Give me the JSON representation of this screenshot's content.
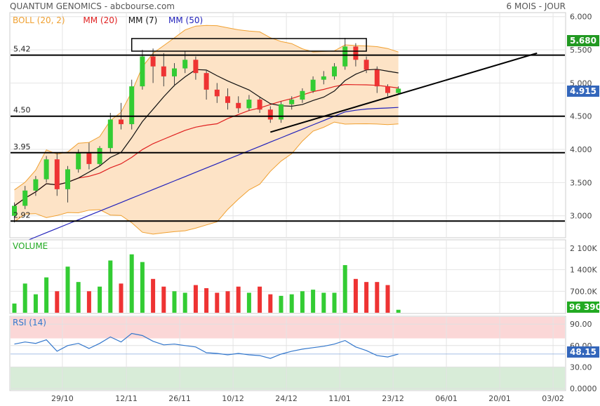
{
  "header": {
    "title": "QUANTUM GENOMICS - abcbourse.com",
    "period": "6 MOIS - JOUR"
  },
  "legend": [
    {
      "label": "BOLL (20, 2)",
      "color": "#f0a030"
    },
    {
      "label": "MM (20)",
      "color": "#e02020"
    },
    {
      "label": "MM (7)",
      "color": "#111111"
    },
    {
      "label": "MM (50)",
      "color": "#2222bb"
    }
  ],
  "colors": {
    "up": "#33cc33",
    "down": "#ee3333",
    "boll_fill": "#fde3c6",
    "boll_line": "#f0a030",
    "mm20": "#e02020",
    "mm7": "#111111",
    "mm50": "#2222bb",
    "rsi_line": "#3377cc",
    "rsi_over": "#fbd7d7",
    "rsi_under": "#d8ecd8",
    "last_price_bg": "#3366bb",
    "last_high_bg": "#229922",
    "last_vol_bg": "#22aa22"
  },
  "main_axis": {
    "ticks": [
      "6.000",
      "5.500",
      "5.000",
      "4.500",
      "4.000",
      "3.500",
      "3.000"
    ],
    "tick_values": [
      6.0,
      5.5,
      5.0,
      4.5,
      4.0,
      3.5,
      3.0
    ],
    "range": [
      2.68,
      6.05
    ]
  },
  "price_badges": {
    "high": "5.680",
    "last": "4.915"
  },
  "annotations": {
    "levels": [
      {
        "label": "5.42",
        "value": 5.42
      },
      {
        "label": "4.50",
        "value": 4.5
      },
      {
        "label": "3.95",
        "value": 3.95
      },
      {
        "label": "2.92",
        "value": 2.92
      }
    ],
    "trendline": {
      "from": [
        24,
        4.26
      ],
      "to": [
        49,
        5.45
      ]
    },
    "box": {
      "from": [
        11,
        5.48
      ],
      "to": [
        33,
        5.67
      ]
    }
  },
  "volume_panel": {
    "label": "VOLUME",
    "ticks": [
      "2 100K",
      "1 400K",
      "700.0K"
    ],
    "tick_values": [
      2100000,
      1400000,
      700000
    ],
    "last_volume": "96 390"
  },
  "rsi_panel": {
    "label": "RSI (14)",
    "ticks": [
      "90.00",
      "60.00",
      "30.00",
      "0.0000"
    ],
    "tick_values": [
      90,
      60,
      30,
      0
    ],
    "last": "48.15",
    "overbought": 70,
    "oversold": 30
  },
  "x_axis": {
    "labels": [
      {
        "label": "29/10",
        "index": 4.5
      },
      {
        "label": "12/11",
        "index": 10.5
      },
      {
        "label": "26/11",
        "index": 15.5
      },
      {
        "label": "10/12",
        "index": 20.5
      },
      {
        "label": "24/12",
        "index": 25.5
      },
      {
        "label": "11/01",
        "index": 30.5
      },
      {
        "label": "23/12",
        "index": 35.5
      },
      {
        "label": "06/01",
        "index": 40.5
      },
      {
        "label": "20/01",
        "index": 45.5
      },
      {
        "label": "03/02",
        "index": 50.5
      }
    ],
    "n_slots": 53
  },
  "chart_data": {
    "type": "candlestick",
    "title": "QUANTUM GENOMICS - abcbourse.com",
    "period": "6 MOIS - JOUR",
    "candles": [
      {
        "o": 3.0,
        "h": 3.2,
        "l": 2.9,
        "c": 3.15
      },
      {
        "o": 3.15,
        "h": 3.45,
        "l": 3.1,
        "c": 3.38
      },
      {
        "o": 3.38,
        "h": 3.6,
        "l": 3.3,
        "c": 3.55
      },
      {
        "o": 3.55,
        "h": 3.9,
        "l": 3.5,
        "c": 3.85
      },
      {
        "o": 3.85,
        "h": 3.95,
        "l": 3.3,
        "c": 3.4
      },
      {
        "o": 3.4,
        "h": 3.75,
        "l": 3.2,
        "c": 3.7
      },
      {
        "o": 3.7,
        "h": 4.0,
        "l": 3.65,
        "c": 3.95
      },
      {
        "o": 3.95,
        "h": 4.1,
        "l": 3.7,
        "c": 3.78
      },
      {
        "o": 3.78,
        "h": 4.05,
        "l": 3.75,
        "c": 4.02
      },
      {
        "o": 4.02,
        "h": 4.55,
        "l": 3.95,
        "c": 4.45
      },
      {
        "o": 4.45,
        "h": 4.7,
        "l": 4.3,
        "c": 4.38
      },
      {
        "o": 4.38,
        "h": 5.05,
        "l": 4.3,
        "c": 4.95
      },
      {
        "o": 4.95,
        "h": 5.5,
        "l": 4.9,
        "c": 5.4
      },
      {
        "o": 5.4,
        "h": 5.52,
        "l": 5.0,
        "c": 5.25
      },
      {
        "o": 5.25,
        "h": 5.45,
        "l": 4.95,
        "c": 5.1
      },
      {
        "o": 5.1,
        "h": 5.3,
        "l": 4.95,
        "c": 5.22
      },
      {
        "o": 5.22,
        "h": 5.48,
        "l": 5.15,
        "c": 5.35
      },
      {
        "o": 5.35,
        "h": 5.4,
        "l": 5.05,
        "c": 5.15
      },
      {
        "o": 5.15,
        "h": 5.2,
        "l": 4.75,
        "c": 4.9
      },
      {
        "o": 4.9,
        "h": 5.0,
        "l": 4.7,
        "c": 4.8
      },
      {
        "o": 4.8,
        "h": 4.92,
        "l": 4.6,
        "c": 4.7
      },
      {
        "o": 4.7,
        "h": 4.8,
        "l": 4.55,
        "c": 4.62
      },
      {
        "o": 4.62,
        "h": 4.82,
        "l": 4.58,
        "c": 4.75
      },
      {
        "o": 4.75,
        "h": 4.78,
        "l": 4.55,
        "c": 4.6
      },
      {
        "o": 4.6,
        "h": 4.65,
        "l": 4.4,
        "c": 4.45
      },
      {
        "o": 4.45,
        "h": 4.72,
        "l": 4.4,
        "c": 4.68
      },
      {
        "o": 4.68,
        "h": 4.8,
        "l": 4.6,
        "c": 4.75
      },
      {
        "o": 4.75,
        "h": 4.92,
        "l": 4.7,
        "c": 4.88
      },
      {
        "o": 4.88,
        "h": 5.1,
        "l": 4.85,
        "c": 5.05
      },
      {
        "o": 5.05,
        "h": 5.18,
        "l": 4.98,
        "c": 5.1
      },
      {
        "o": 5.1,
        "h": 5.3,
        "l": 5.05,
        "c": 5.25
      },
      {
        "o": 5.25,
        "h": 5.68,
        "l": 5.2,
        "c": 5.55
      },
      {
        "o": 5.55,
        "h": 5.6,
        "l": 5.25,
        "c": 5.35
      },
      {
        "o": 5.35,
        "h": 5.4,
        "l": 5.15,
        "c": 5.2
      },
      {
        "o": 5.2,
        "h": 5.25,
        "l": 4.85,
        "c": 4.95
      },
      {
        "o": 4.95,
        "h": 4.98,
        "l": 4.8,
        "c": 4.85
      },
      {
        "o": 4.85,
        "h": 4.95,
        "l": 4.83,
        "c": 4.915
      }
    ],
    "volume": [
      300000,
      950000,
      600000,
      1150000,
      700000,
      1500000,
      1000000,
      700000,
      850000,
      1700000,
      950000,
      1900000,
      1650000,
      1100000,
      850000,
      700000,
      650000,
      900000,
      800000,
      650000,
      700000,
      850000,
      650000,
      850000,
      600000,
      550000,
      600000,
      700000,
      750000,
      650000,
      650000,
      1550000,
      1100000,
      1000000,
      1000000,
      900000,
      96390
    ],
    "rsi": [
      62,
      65,
      63,
      68,
      52,
      60,
      63,
      56,
      63,
      72,
      65,
      77,
      74,
      66,
      61,
      62,
      60,
      58,
      50,
      49,
      47,
      49,
      47,
      46,
      42,
      48,
      52,
      55,
      57,
      59,
      62,
      67,
      58,
      53,
      46,
      44,
      48.15
    ]
  }
}
